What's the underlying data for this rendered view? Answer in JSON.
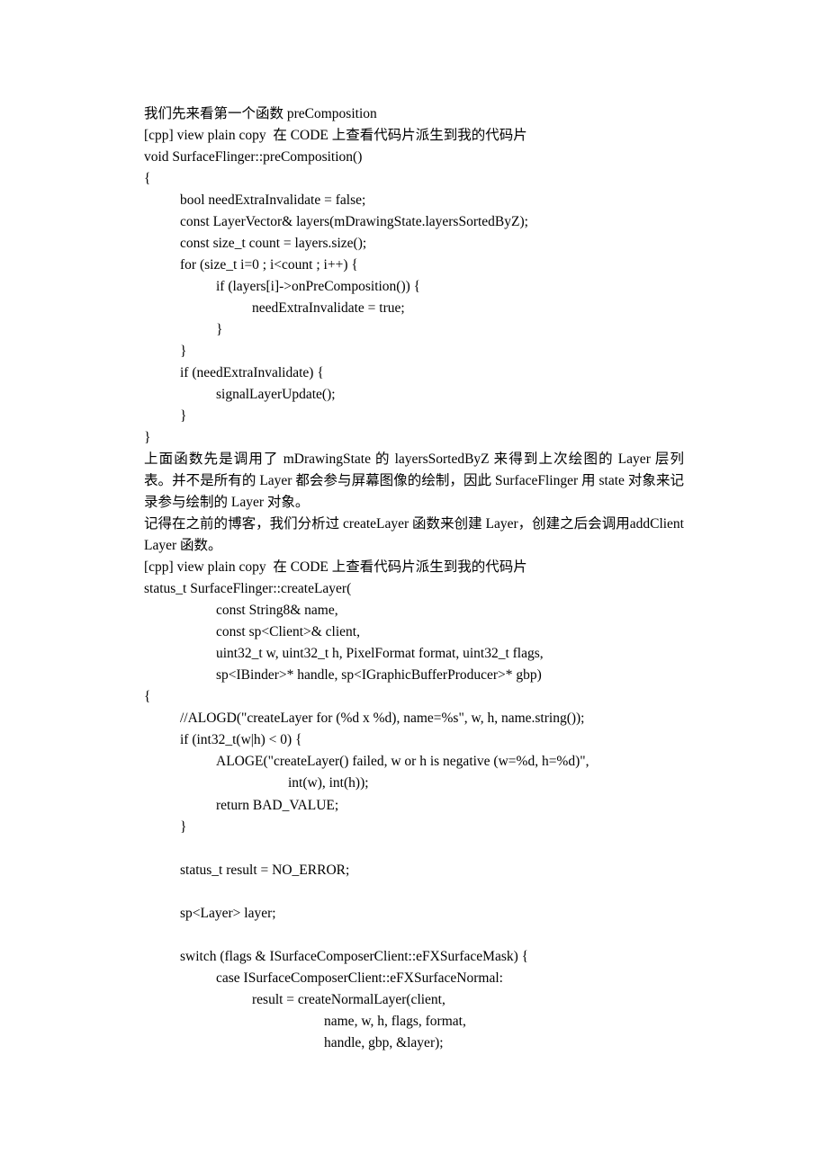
{
  "lines": [
    {
      "cls": "indent0",
      "text": "我们先来看第一个函数 preComposition"
    },
    {
      "cls": "indent0",
      "text": "[cpp] view plain copy  在 CODE 上查看代码片派生到我的代码片"
    },
    {
      "cls": "indent0",
      "text": "void SurfaceFlinger::preComposition()"
    },
    {
      "cls": "indent0",
      "text": "{"
    },
    {
      "cls": "indent1",
      "text": "bool needExtraInvalidate = false;"
    },
    {
      "cls": "indent1",
      "text": "const LayerVector& layers(mDrawingState.layersSortedByZ);"
    },
    {
      "cls": "indent1",
      "text": "const size_t count = layers.size();"
    },
    {
      "cls": "indent1",
      "text": "for (size_t i=0 ; i<count ; i++) {"
    },
    {
      "cls": "indent2",
      "text": "if (layers[i]->onPreComposition()) {"
    },
    {
      "cls": "indent3",
      "text": "needExtraInvalidate = true;"
    },
    {
      "cls": "indent2",
      "text": "}"
    },
    {
      "cls": "indent1",
      "text": "}"
    },
    {
      "cls": "indent1",
      "text": "if (needExtraInvalidate) {"
    },
    {
      "cls": "indent2",
      "text": "signalLayerUpdate();"
    },
    {
      "cls": "indent1",
      "text": "}"
    },
    {
      "cls": "indent0",
      "text": "}"
    },
    {
      "cls": "indent0 justify",
      "text": "上面函数先是调用了 mDrawingState 的 layersSortedByZ 来得到上次绘图的 Layer 层列表。并不是所有的 Layer 都会参与屏幕图像的绘制，因此 SurfaceFlinger 用 state 对象来记录参与绘制的 Layer 对象。"
    },
    {
      "cls": "indent0 justify",
      "text": "记得在之前的博客，我们分析过 createLayer 函数来创建 Layer，创建之后会调用addClientLayer 函数。"
    },
    {
      "cls": "indent0",
      "text": "[cpp] view plain copy  在 CODE 上查看代码片派生到我的代码片"
    },
    {
      "cls": "indent0",
      "text": "status_t SurfaceFlinger::createLayer("
    },
    {
      "cls": "indent2",
      "text": "const String8& name,"
    },
    {
      "cls": "indent2",
      "text": "const sp<Client>& client,"
    },
    {
      "cls": "indent2",
      "text": "uint32_t w, uint32_t h, PixelFormat format, uint32_t flags,"
    },
    {
      "cls": "indent2",
      "text": "sp<IBinder>* handle, sp<IGraphicBufferProducer>* gbp)"
    },
    {
      "cls": "indent0",
      "text": "{"
    },
    {
      "cls": "indent1",
      "text": "//ALOGD(\"createLayer for (%d x %d), name=%s\", w, h, name.string());"
    },
    {
      "cls": "indent1",
      "text": "if (int32_t(w|h) < 0) {"
    },
    {
      "cls": "indent2",
      "text": "ALOGE(\"createLayer() failed, w or h is negative (w=%d, h=%d)\","
    },
    {
      "cls": "indent4",
      "text": "int(w), int(h));"
    },
    {
      "cls": "indent2",
      "text": "return BAD_VALUE;"
    },
    {
      "cls": "indent1",
      "text": "}"
    },
    {
      "cls": "blank",
      "text": ""
    },
    {
      "cls": "indent1",
      "text": "status_t result = NO_ERROR;"
    },
    {
      "cls": "blank",
      "text": ""
    },
    {
      "cls": "indent1",
      "text": "sp<Layer> layer;"
    },
    {
      "cls": "blank",
      "text": ""
    },
    {
      "cls": "indent1",
      "text": "switch (flags & ISurfaceComposerClient::eFXSurfaceMask) {"
    },
    {
      "cls": "indent2",
      "text": "case ISurfaceComposerClient::eFXSurfaceNormal:"
    },
    {
      "cls": "indent3",
      "text": "result = createNormalLayer(client,"
    },
    {
      "cls": "indent5",
      "text": "name, w, h, flags, format,"
    },
    {
      "cls": "indent5",
      "text": "handle, gbp, &layer);"
    }
  ]
}
